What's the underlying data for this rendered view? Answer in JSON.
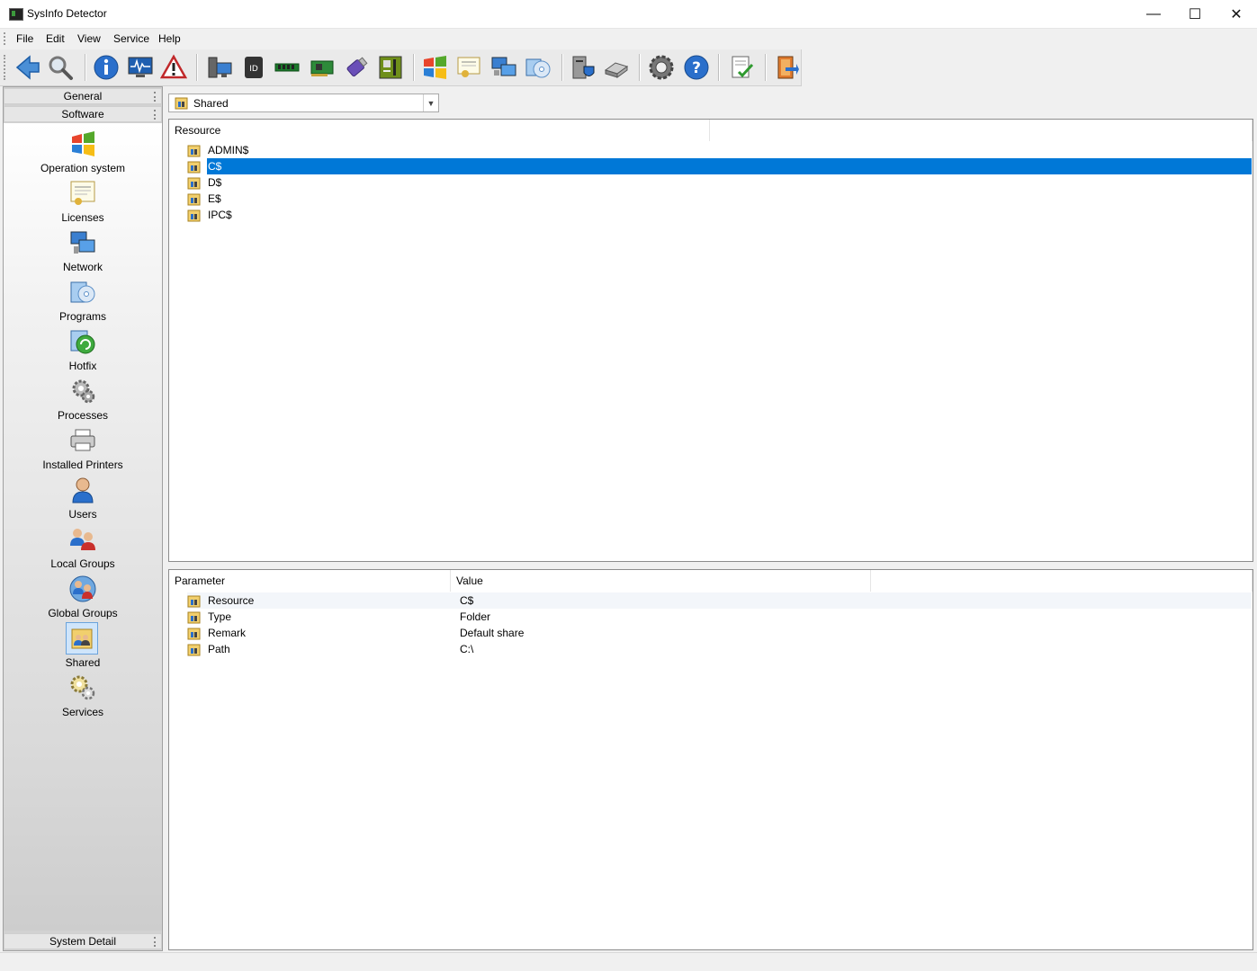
{
  "window": {
    "title": "SysInfo Detector",
    "minimize": "—",
    "maximize": "☐",
    "close": "✕"
  },
  "menu": [
    "File",
    "Edit",
    "View",
    "Service",
    "Help"
  ],
  "toolbar": [
    "back-arrow-icon",
    "search-icon",
    "info-icon",
    "monitor-graph-icon",
    "warning-icon",
    "computer-icon",
    "cpu-id-icon",
    "memory-icon",
    "expansion-card-icon",
    "usb-drive-icon",
    "motherboard-icon",
    "windows-logo-icon",
    "license-certificate-icon",
    "network-computers-icon",
    "programs-cd-icon",
    "security-server-icon",
    "disk-drives-icon",
    "settings-gear-icon",
    "help-icon",
    "report-check-icon",
    "exit-door-icon"
  ],
  "sidebar": {
    "categories": {
      "general": "General",
      "software": "Software",
      "system_detail": "System Detail"
    },
    "items": [
      {
        "label": "Operation system",
        "icon": "windows-logo-icon"
      },
      {
        "label": "Licenses",
        "icon": "certificate-icon"
      },
      {
        "label": "Network",
        "icon": "network-icon"
      },
      {
        "label": "Programs",
        "icon": "programs-icon"
      },
      {
        "label": "Hotfix",
        "icon": "hotfix-icon"
      },
      {
        "label": "Processes",
        "icon": "processes-gear-icon"
      },
      {
        "label": "Installed Printers",
        "icon": "printer-icon"
      },
      {
        "label": "Users",
        "icon": "user-icon"
      },
      {
        "label": "Local Groups",
        "icon": "local-groups-icon"
      },
      {
        "label": "Global Groups",
        "icon": "global-groups-icon"
      },
      {
        "label": "Shared",
        "icon": "shared-folder-icon",
        "selected": true
      },
      {
        "label": "Services",
        "icon": "services-gears-icon"
      }
    ]
  },
  "view_selector": {
    "value": "Shared"
  },
  "resources": {
    "column": "Resource",
    "rows": [
      "ADMIN$",
      "C$",
      "D$",
      "E$",
      "IPC$"
    ],
    "selected": "C$"
  },
  "details": {
    "columns": [
      "Parameter",
      "Value"
    ],
    "rows": [
      {
        "param": "Resource",
        "value": "C$"
      },
      {
        "param": "Type",
        "value": "Folder"
      },
      {
        "param": "Remark",
        "value": "Default share"
      },
      {
        "param": "Path",
        "value": "C:\\"
      }
    ]
  },
  "colors": {
    "selection": "#0078d7",
    "panel": "#d2d2d2"
  }
}
